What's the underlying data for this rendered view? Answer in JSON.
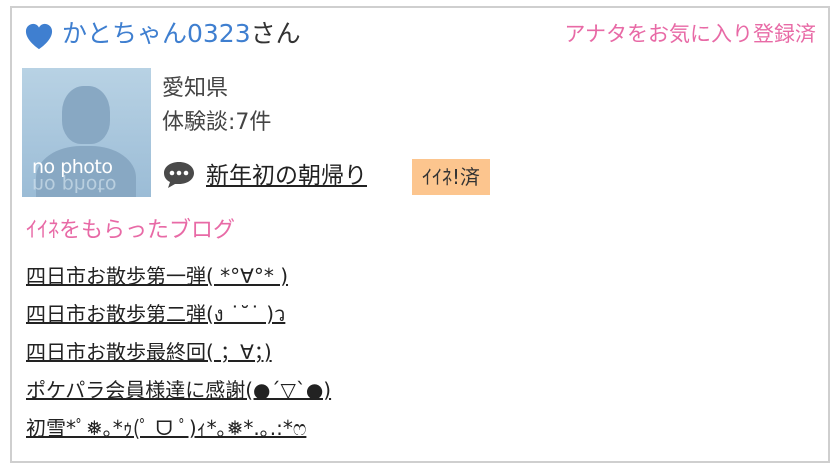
{
  "header": {
    "username": "かとちゃん0323",
    "honorific": "さん",
    "favorite_status": "アナタをお気に入り登録済"
  },
  "profile": {
    "avatar_text": "no photo",
    "prefecture": "愛知県",
    "experience_count": "体験談:7件",
    "latest_post_title": "新年初の朝帰り",
    "iine_badge": "ｲｲﾈ!済"
  },
  "liked_blogs": {
    "title": "ｲｲﾈをもらったブログ",
    "items": [
      "四日市お散歩第一弾( *°∀°* )",
      "四日市お散歩第二弾(ง ˙˘˙ )ว",
      "四日市お散歩最終回( ；∀；)",
      "ポケパラ会員様達に感謝(●´▽`●)",
      "初雪*ﾟ❅｡*ｩ(ﾟ ᗜ ﾟ)ｨ*｡❅*.｡.:*ෆ"
    ]
  },
  "colors": {
    "username": "#3f7fd0",
    "accent_pink": "#e86aa6",
    "badge_bg": "#fcc58e",
    "heart": "#3f7fd0"
  },
  "icons": {
    "heart": "heart-icon",
    "speech": "speech-bubble-icon"
  }
}
